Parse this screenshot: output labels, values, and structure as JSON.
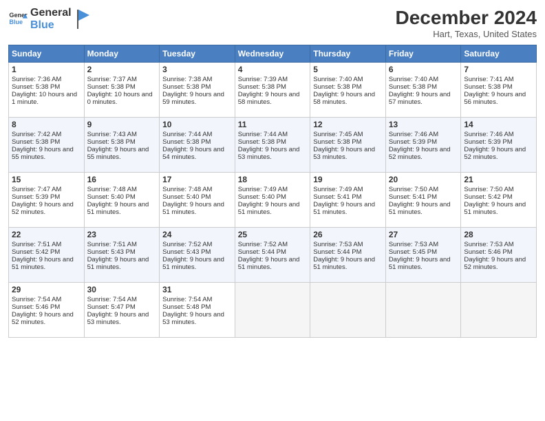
{
  "header": {
    "logo_line1": "General",
    "logo_line2": "Blue",
    "month_title": "December 2024",
    "location": "Hart, Texas, United States"
  },
  "days_of_week": [
    "Sunday",
    "Monday",
    "Tuesday",
    "Wednesday",
    "Thursday",
    "Friday",
    "Saturday"
  ],
  "weeks": [
    [
      {
        "day": 1,
        "sunrise": "7:36 AM",
        "sunset": "5:38 PM",
        "daylight": "10 hours and 1 minute."
      },
      {
        "day": 2,
        "sunrise": "7:37 AM",
        "sunset": "5:38 PM",
        "daylight": "10 hours and 0 minutes."
      },
      {
        "day": 3,
        "sunrise": "7:38 AM",
        "sunset": "5:38 PM",
        "daylight": "9 hours and 59 minutes."
      },
      {
        "day": 4,
        "sunrise": "7:39 AM",
        "sunset": "5:38 PM",
        "daylight": "9 hours and 58 minutes."
      },
      {
        "day": 5,
        "sunrise": "7:40 AM",
        "sunset": "5:38 PM",
        "daylight": "9 hours and 58 minutes."
      },
      {
        "day": 6,
        "sunrise": "7:40 AM",
        "sunset": "5:38 PM",
        "daylight": "9 hours and 57 minutes."
      },
      {
        "day": 7,
        "sunrise": "7:41 AM",
        "sunset": "5:38 PM",
        "daylight": "9 hours and 56 minutes."
      }
    ],
    [
      {
        "day": 8,
        "sunrise": "7:42 AM",
        "sunset": "5:38 PM",
        "daylight": "9 hours and 55 minutes."
      },
      {
        "day": 9,
        "sunrise": "7:43 AM",
        "sunset": "5:38 PM",
        "daylight": "9 hours and 55 minutes."
      },
      {
        "day": 10,
        "sunrise": "7:44 AM",
        "sunset": "5:38 PM",
        "daylight": "9 hours and 54 minutes."
      },
      {
        "day": 11,
        "sunrise": "7:44 AM",
        "sunset": "5:38 PM",
        "daylight": "9 hours and 53 minutes."
      },
      {
        "day": 12,
        "sunrise": "7:45 AM",
        "sunset": "5:38 PM",
        "daylight": "9 hours and 53 minutes."
      },
      {
        "day": 13,
        "sunrise": "7:46 AM",
        "sunset": "5:39 PM",
        "daylight": "9 hours and 52 minutes."
      },
      {
        "day": 14,
        "sunrise": "7:46 AM",
        "sunset": "5:39 PM",
        "daylight": "9 hours and 52 minutes."
      }
    ],
    [
      {
        "day": 15,
        "sunrise": "7:47 AM",
        "sunset": "5:39 PM",
        "daylight": "9 hours and 52 minutes."
      },
      {
        "day": 16,
        "sunrise": "7:48 AM",
        "sunset": "5:40 PM",
        "daylight": "9 hours and 51 minutes."
      },
      {
        "day": 17,
        "sunrise": "7:48 AM",
        "sunset": "5:40 PM",
        "daylight": "9 hours and 51 minutes."
      },
      {
        "day": 18,
        "sunrise": "7:49 AM",
        "sunset": "5:40 PM",
        "daylight": "9 hours and 51 minutes."
      },
      {
        "day": 19,
        "sunrise": "7:49 AM",
        "sunset": "5:41 PM",
        "daylight": "9 hours and 51 minutes."
      },
      {
        "day": 20,
        "sunrise": "7:50 AM",
        "sunset": "5:41 PM",
        "daylight": "9 hours and 51 minutes."
      },
      {
        "day": 21,
        "sunrise": "7:50 AM",
        "sunset": "5:42 PM",
        "daylight": "9 hours and 51 minutes."
      }
    ],
    [
      {
        "day": 22,
        "sunrise": "7:51 AM",
        "sunset": "5:42 PM",
        "daylight": "9 hours and 51 minutes."
      },
      {
        "day": 23,
        "sunrise": "7:51 AM",
        "sunset": "5:43 PM",
        "daylight": "9 hours and 51 minutes."
      },
      {
        "day": 24,
        "sunrise": "7:52 AM",
        "sunset": "5:43 PM",
        "daylight": "9 hours and 51 minutes."
      },
      {
        "day": 25,
        "sunrise": "7:52 AM",
        "sunset": "5:44 PM",
        "daylight": "9 hours and 51 minutes."
      },
      {
        "day": 26,
        "sunrise": "7:53 AM",
        "sunset": "5:44 PM",
        "daylight": "9 hours and 51 minutes."
      },
      {
        "day": 27,
        "sunrise": "7:53 AM",
        "sunset": "5:45 PM",
        "daylight": "9 hours and 51 minutes."
      },
      {
        "day": 28,
        "sunrise": "7:53 AM",
        "sunset": "5:46 PM",
        "daylight": "9 hours and 52 minutes."
      }
    ],
    [
      {
        "day": 29,
        "sunrise": "7:54 AM",
        "sunset": "5:46 PM",
        "daylight": "9 hours and 52 minutes."
      },
      {
        "day": 30,
        "sunrise": "7:54 AM",
        "sunset": "5:47 PM",
        "daylight": "9 hours and 53 minutes."
      },
      {
        "day": 31,
        "sunrise": "7:54 AM",
        "sunset": "5:48 PM",
        "daylight": "9 hours and 53 minutes."
      },
      null,
      null,
      null,
      null
    ]
  ],
  "labels": {
    "sunrise": "Sunrise:",
    "sunset": "Sunset:",
    "daylight": "Daylight:"
  }
}
